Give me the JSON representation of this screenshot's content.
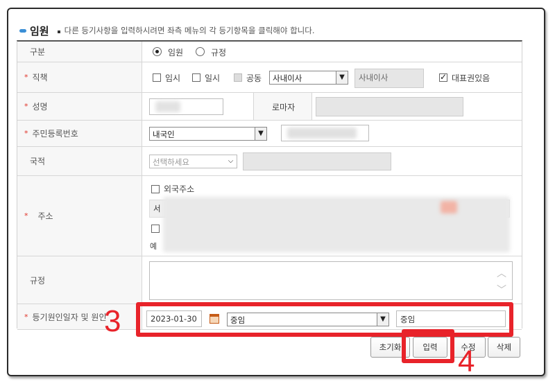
{
  "header": {
    "title": "임원",
    "description": "다른 등기사항을 입력하시려면 좌측 메뉴의 각 등기항목을 클릭해야 합니다."
  },
  "rows": {
    "gubun": {
      "label": "구분",
      "options": [
        {
          "label": "임원",
          "checked": true
        },
        {
          "label": "규정",
          "checked": false
        }
      ]
    },
    "position": {
      "label": "직책",
      "checkboxes": [
        {
          "label": "임시",
          "checked": false
        },
        {
          "label": "일시",
          "checked": false
        },
        {
          "label": "공동",
          "checked": false,
          "disabled": true
        }
      ],
      "select_value": "사내이사",
      "readonly_value": "사내이사",
      "rep_label": "대표권있음",
      "rep_checked": true
    },
    "name": {
      "label": "성명",
      "roman_label": "로마자"
    },
    "resident": {
      "label": "주민등록번호",
      "select_value": "내국인"
    },
    "nationality": {
      "label": "국적",
      "select_placeholder": "선택하세요"
    },
    "address": {
      "label": "주소",
      "foreign_label": "외국주소",
      "partial_line1": "서",
      "partial_line3": "예"
    },
    "rule": {
      "label": "규정"
    },
    "registration": {
      "label": "등기원인일자 및 원인",
      "date": "2023-01-30",
      "cause_select": "중임",
      "cause_text": "중임"
    }
  },
  "buttons": {
    "reset": "초기화",
    "input": "입력",
    "modify": "수정",
    "delete": "삭제"
  },
  "annotations": {
    "step3": "3",
    "step4": "4",
    "color": "#e8232a"
  }
}
